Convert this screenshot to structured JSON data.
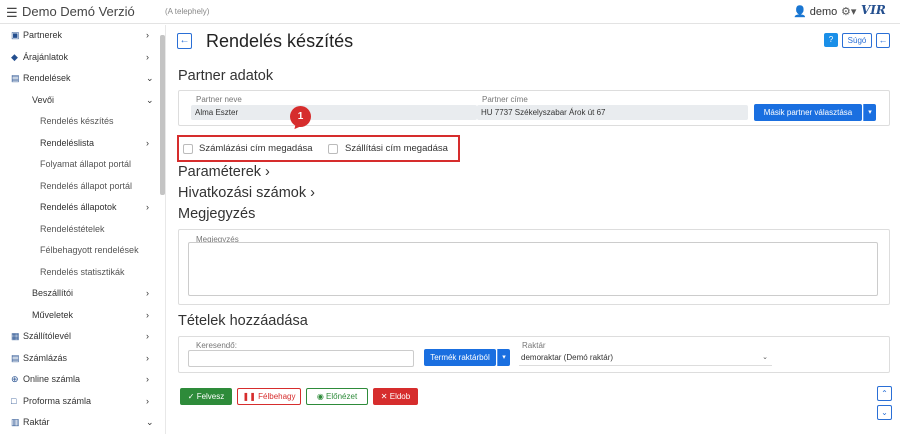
{
  "header": {
    "menu_icon": "hamburger-icon",
    "title": "Demo Demó Verzió",
    "subtitle": "(A telephely)",
    "user": "demo",
    "logo": "VIR"
  },
  "sidebar": {
    "items": [
      {
        "label": "Partnerek",
        "icon": "partner-icon",
        "chevron": "›"
      },
      {
        "label": "Árajánlatok",
        "icon": "quote-icon",
        "chevron": "›"
      },
      {
        "label": "Rendelések",
        "icon": "order-icon",
        "chevron": "⌄"
      },
      {
        "label": "Vevői",
        "chevron": "⌄"
      },
      {
        "label": "Rendelés készítés"
      },
      {
        "label": "Rendeléslista",
        "chevron": "›"
      },
      {
        "label": "Folyamat állapot portál"
      },
      {
        "label": "Rendelés állapot portál"
      },
      {
        "label": "Rendelés állapotok",
        "chevron": "›"
      },
      {
        "label": "Rendeléstételek"
      },
      {
        "label": "Félbehagyott rendelések"
      },
      {
        "label": "Rendelés statisztikák"
      },
      {
        "label": "Beszállítói",
        "chevron": "›"
      },
      {
        "label": "Műveletek",
        "chevron": "›"
      },
      {
        "label": "Szállítólevél",
        "icon": "delivery-note-icon",
        "chevron": "›"
      },
      {
        "label": "Számlázás",
        "icon": "invoice-icon",
        "chevron": "›"
      },
      {
        "label": "Online számla",
        "icon": "globe-icon",
        "chevron": "›"
      },
      {
        "label": "Proforma számla",
        "icon": "proforma-icon",
        "chevron": "›"
      },
      {
        "label": "Raktár",
        "icon": "warehouse-icon",
        "chevron": "⌄"
      }
    ]
  },
  "page": {
    "title": "Rendelés készítés",
    "help_label": "Súgó"
  },
  "partner": {
    "section_title": "Partner adatok",
    "name_label": "Partner neve",
    "name_value": "Alma Eszter",
    "address_label": "Partner címe",
    "address_value": "HU 7737 Székelyszabar Árok út 67",
    "other_partner_button": "Másik partner választása"
  },
  "callout_number": "1",
  "checkboxes": {
    "billing": "Számlázási cím megadása",
    "shipping": "Szállítási cím megadása"
  },
  "sections": {
    "parameters": "Paraméterek",
    "references": "Hivatkozási számok",
    "notes": "Megjegyzés",
    "items": "Tételek hozzáadása"
  },
  "notes": {
    "field_label": "Megjegyzés"
  },
  "items": {
    "search_label": "Keresendő:",
    "search_value": "",
    "product_button": "Termék raktárból",
    "warehouse_label": "Raktár",
    "warehouse_value": "demoraktar (Demó raktár)"
  },
  "actions": {
    "save": "Felvesz",
    "pause": "Félbehagy",
    "preview": "Előnézet",
    "discard": "Eldob"
  },
  "colors": {
    "primary": "#1a6fe0",
    "danger": "#d62d2d",
    "success": "#2e8b3a",
    "brand": "#244f8f"
  }
}
